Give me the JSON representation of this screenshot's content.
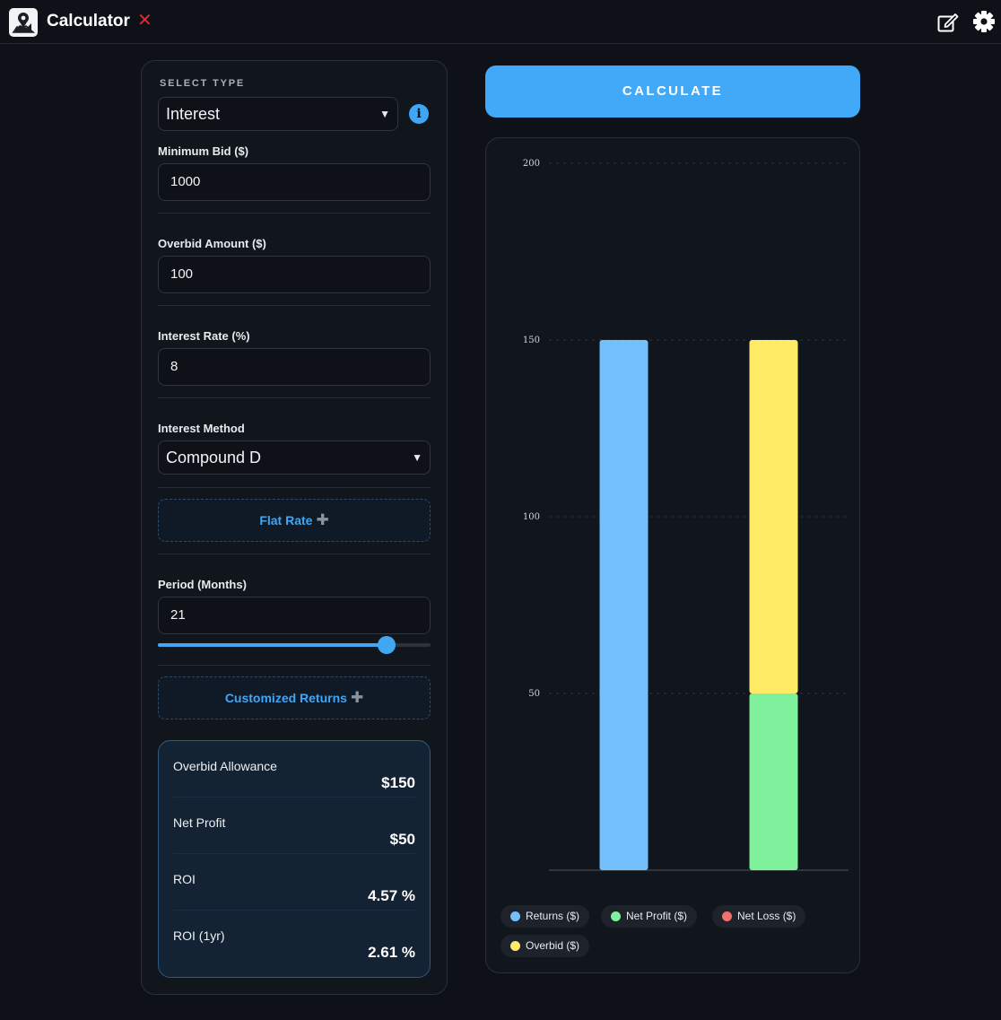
{
  "app": {
    "title": "Calculator",
    "close_glyph": "✕",
    "icons": [
      "map-pin-logo-icon",
      "edit-icon",
      "gear-icon"
    ]
  },
  "form": {
    "select_type_label": "SELECT TYPE",
    "select_type_value": "Interest",
    "minimum_bid_label": "Minimum Bid ($)",
    "minimum_bid_value": "1000",
    "overbid_amount_label": "Overbid Amount ($)",
    "overbid_amount_value": "100",
    "interest_rate_label": "Interest Rate (%)",
    "interest_rate_value": "8",
    "interest_method_label": "Interest Method",
    "interest_method_value": "Compound D",
    "flat_rate_label": "Flat Rate",
    "period_label": "Period (Months)",
    "period_value": "21",
    "period_slider_fraction": 0.84,
    "customized_returns_label": "Customized Returns"
  },
  "results": [
    {
      "label": "Overbid Allowance",
      "value": "$150"
    },
    {
      "label": "Net Profit",
      "value": "$50"
    },
    {
      "label": "ROI",
      "value": "4.57 %"
    },
    {
      "label": "ROI (1yr)",
      "value": "2.61 %"
    }
  ],
  "calculate_label": "CALCULATE",
  "colors": {
    "accent": "#42a9f8",
    "returns": "#74c0fc",
    "net_profit": "#7ff09b",
    "net_loss": "#f07070",
    "overbid": "#ffeb66"
  },
  "chart_data": {
    "type": "bar",
    "stacked": true,
    "ylim": [
      0,
      200
    ],
    "yticks": [
      "200",
      "150",
      "100",
      "50"
    ],
    "ytick_values": [
      200,
      150,
      100,
      50
    ],
    "grid": true,
    "legend_position": "bottom",
    "bars": [
      {
        "segments": [
          {
            "series": "Returns ($)",
            "value": 150
          }
        ]
      },
      {
        "segments": [
          {
            "series": "Net Profit ($)",
            "value": 50
          },
          {
            "series": "Overbid ($)",
            "value": 100
          }
        ]
      }
    ],
    "series": [
      {
        "name": "Returns ($)",
        "color": "#74c0fc"
      },
      {
        "name": "Net Profit ($)",
        "color": "#7ff09b"
      },
      {
        "name": "Net Loss ($)",
        "color": "#f07070"
      },
      {
        "name": "Overbid ($)",
        "color": "#ffeb66"
      }
    ]
  }
}
